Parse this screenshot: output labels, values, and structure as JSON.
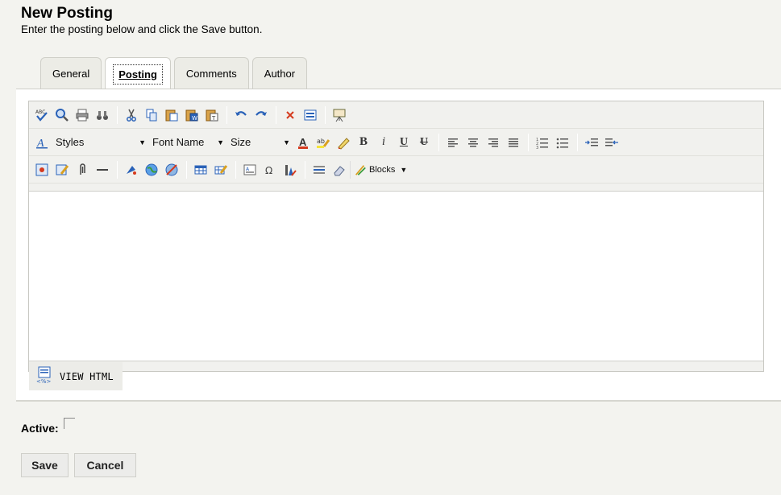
{
  "header": {
    "title": "New Posting",
    "subtitle": "Enter the posting below and click the Save button."
  },
  "tabs": [
    {
      "label": "General",
      "active": false
    },
    {
      "label": "Posting",
      "active": true
    },
    {
      "label": "Comments",
      "active": false
    },
    {
      "label": "Author",
      "active": false
    }
  ],
  "editor": {
    "toolbar": {
      "styles_label": "Styles",
      "fontname_label": "Font Name",
      "size_label": "Size",
      "blocks_label": "Blocks",
      "bold_glyph": "B",
      "italic_glyph": "i",
      "underline_glyph": "U",
      "strike_glyph": "U"
    },
    "content": "",
    "view_html_label": "VIEW HTML"
  },
  "form": {
    "active_label": "Active:",
    "active_checked": false,
    "save_label": "Save",
    "cancel_label": "Cancel"
  },
  "colors": {
    "background": "#f3f3ef",
    "panel": "#ffffff",
    "icon_blue": "#2a62b8",
    "icon_red": "#d53a1e"
  }
}
